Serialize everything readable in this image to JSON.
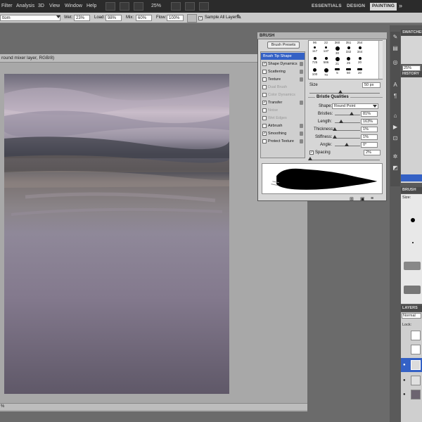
{
  "menubar": {
    "items": [
      "Filter",
      "Analysis",
      "3D",
      "View",
      "Window",
      "Help"
    ],
    "zoom": "25%",
    "workspaces": [
      "ESSENTIALS",
      "DESIGN",
      "PAINTING"
    ],
    "active_workspace": "PAINTING"
  },
  "options_bar": {
    "mode_value": "ttom",
    "wet_label": "Wet:",
    "wet_value": "23%",
    "load_label": "Load:",
    "load_value": "98%",
    "mix_label": "Mix:",
    "mix_value": "60%",
    "flow_label": "Flow:",
    "flow_value": "100%",
    "sample_all_layers": "Sample All Layers"
  },
  "document": {
    "title": "round mixer layer, RGB/8)",
    "status": "%"
  },
  "brush_panel": {
    "tab": "BRUSH",
    "presets_button": "Brush Presets",
    "options": [
      {
        "label": "Brush Tip Shape",
        "checked": null,
        "enabled": true,
        "selected": true
      },
      {
        "label": "Shape Dynamics",
        "checked": true,
        "enabled": true
      },
      {
        "label": "Scattering",
        "checked": false,
        "enabled": true
      },
      {
        "label": "Texture",
        "checked": false,
        "enabled": true
      },
      {
        "label": "Dual Brush",
        "checked": false,
        "enabled": false
      },
      {
        "label": "Color Dynamics",
        "checked": false,
        "enabled": false
      },
      {
        "label": "Transfer",
        "checked": true,
        "enabled": true
      },
      {
        "label": "Noise",
        "checked": false,
        "enabled": false
      },
      {
        "label": "Wet Edges",
        "checked": false,
        "enabled": false
      },
      {
        "label": "Airbrush",
        "checked": false,
        "enabled": true
      },
      {
        "label": "Smoothing",
        "checked": true,
        "enabled": true
      },
      {
        "label": "Protect Texture",
        "checked": false,
        "enabled": true
      }
    ],
    "tip_sizes": [
      "96",
      "22",
      "360",
      "351",
      "254",
      "117",
      "137",
      "30",
      "332",
      "344",
      "725",
      "586",
      "21",
      "25",
      "20",
      "100",
      "70",
      "5",
      "50",
      "20"
    ],
    "size_label": "Size",
    "size_value": "50 px",
    "bristle_title": "Bristle Qualities",
    "shape_label": "Shape:",
    "shape_value": "Round Point",
    "bristles_label": "Bristles:",
    "bristles_value": "81%",
    "length_label": "Length:",
    "length_value": "163%",
    "thickness_label": "Thickness:",
    "thickness_value": "1%",
    "stiffness_label": "Stiffness:",
    "stiffness_value": "1%",
    "angle_label": "Angle:",
    "angle_value": "0°",
    "spacing_label": "Spacing",
    "spacing_value": "2%"
  },
  "right_panels": {
    "swatches": "SWATCHES",
    "percent": "25%",
    "history": "HISTORY",
    "brush_presets": "BRUSH PR",
    "size_label": "Size:",
    "layers": "LAYERS",
    "blend_mode": "Normal",
    "lock_label": "Lock:"
  }
}
